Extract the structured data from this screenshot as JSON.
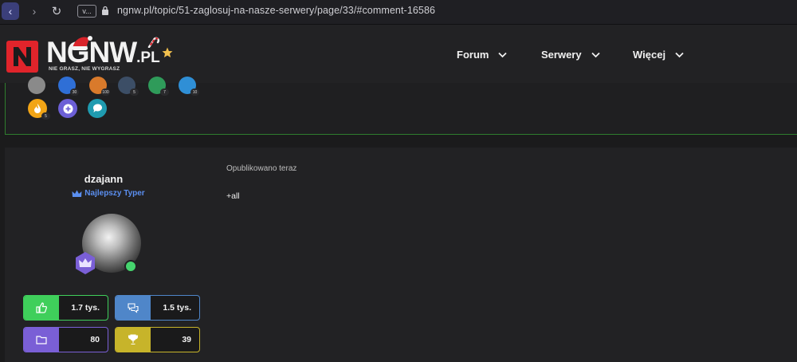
{
  "browser": {
    "site_info": "v...",
    "url": "ngnw.pl/topic/51-zaglosuj-na-nasze-serwery/page/33/#comment-16586"
  },
  "logo": {
    "text": "NGNW",
    "suffix": ".PL",
    "tagline": "NIE GRASZ, NIE WYGRASZ",
    "brand_color": "#e0242b"
  },
  "nav": {
    "items": [
      {
        "label": "Forum"
      },
      {
        "label": "Serwery"
      },
      {
        "label": "Więcej"
      }
    ]
  },
  "prev_post": {
    "badges": [
      {
        "icon": "flame-icon",
        "color": "#f2a516",
        "count": "5"
      },
      {
        "icon": "plus-icon",
        "color": "#6c5fd6",
        "count": ""
      },
      {
        "icon": "chat-icon",
        "color": "#1f9bb0",
        "count": ""
      }
    ],
    "partial_badges": [
      {
        "count": "30"
      },
      {
        "count": "100"
      },
      {
        "count": "5"
      },
      {
        "count": "7"
      },
      {
        "count": "10"
      }
    ]
  },
  "post": {
    "author": {
      "name": "dzajann",
      "rank": "Najlepszy Typer",
      "rank_color": "#5b8ff0",
      "online": true
    },
    "stats": [
      {
        "icon": "thumbs-up-icon",
        "value": "1.7 tys.",
        "color": "#3fcf5b"
      },
      {
        "icon": "chat-bubbles-icon",
        "value": "1.5 tys.",
        "color": "#4f86c9"
      },
      {
        "icon": "folder-icon",
        "value": "80",
        "color": "#7a5fd6"
      },
      {
        "icon": "trophy-icon",
        "value": "39",
        "color": "#c7b42a"
      }
    ],
    "published": "Opublikowano teraz",
    "body": "+all"
  }
}
